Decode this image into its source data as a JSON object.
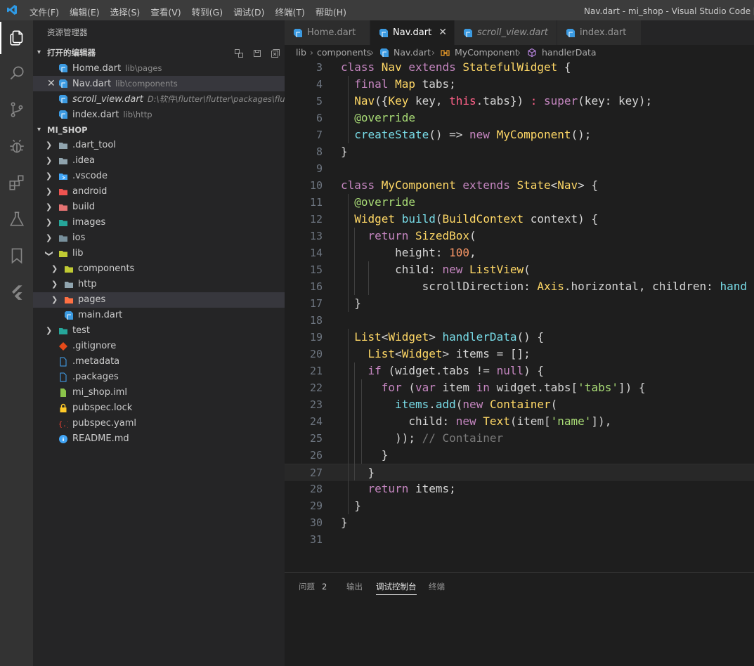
{
  "titlebar": {
    "menu": [
      "文件(F)",
      "编辑(E)",
      "选择(S)",
      "查看(V)",
      "转到(G)",
      "调试(D)",
      "终端(T)",
      "帮助(H)"
    ],
    "window_title": "Nav.dart - mi_shop - Visual Studio Code [管理"
  },
  "activity_bar": [
    "explorer-icon",
    "search-icon",
    "source-control-icon",
    "debug-icon",
    "extensions-icon",
    "test-icon",
    "bookmarks-icon",
    "flutter-icon"
  ],
  "sidebar": {
    "title": "资源管理器",
    "open_editors": {
      "header": "打开的编辑器",
      "items": [
        {
          "name": "Home.dart",
          "desc": "lib\\pages"
        },
        {
          "name": "Nav.dart",
          "desc": "lib\\components"
        },
        {
          "name": "scroll_view.dart",
          "desc": "D:\\软件\\flutter\\flutter\\packages\\flutter..."
        },
        {
          "name": "index.dart",
          "desc": "lib\\http"
        }
      ]
    },
    "project": {
      "header": "MI_SHOP",
      "items": [
        {
          "name": ".dart_tool"
        },
        {
          "name": ".idea"
        },
        {
          "name": ".vscode"
        },
        {
          "name": "android"
        },
        {
          "name": "build"
        },
        {
          "name": "images"
        },
        {
          "name": "ios"
        },
        {
          "name": "lib"
        },
        {
          "name": "components"
        },
        {
          "name": "http"
        },
        {
          "name": "pages"
        },
        {
          "name": "main.dart"
        },
        {
          "name": "test"
        },
        {
          "name": ".gitignore"
        },
        {
          "name": ".metadata"
        },
        {
          "name": ".packages"
        },
        {
          "name": "mi_shop.iml"
        },
        {
          "name": "pubspec.lock"
        },
        {
          "name": "pubspec.yaml"
        },
        {
          "name": "README.md"
        }
      ]
    }
  },
  "tabs": [
    "Home.dart",
    "Nav.dart",
    "scroll_view.dart",
    "index.dart"
  ],
  "breadcrumb": [
    "lib",
    "components",
    "Nav.dart",
    "MyComponent",
    "handlerData"
  ],
  "editor": {
    "line_numbers": [
      "3",
      "4",
      "5",
      "6",
      "7",
      "8",
      "9",
      "10",
      "11",
      "12",
      "13",
      "14",
      "15",
      "16",
      "17",
      "18",
      "19",
      "20",
      "21",
      "22",
      "23",
      "24",
      "25",
      "26",
      "27",
      "28",
      "29",
      "30",
      "31"
    ],
    "lines": [
      [
        [
          "k",
          "class "
        ],
        [
          "t",
          "Nav "
        ],
        [
          "k",
          "extends "
        ],
        [
          "t",
          "StatefulWidget "
        ],
        [
          "v",
          "{"
        ]
      ],
      [
        [
          "v",
          "  "
        ],
        [
          "k",
          "final "
        ],
        [
          "t",
          "Map "
        ],
        [
          "v",
          "tabs;"
        ]
      ],
      [
        [
          "v",
          "  "
        ],
        [
          "t",
          "Nav"
        ],
        [
          "v",
          "({"
        ],
        [
          "t",
          "Key "
        ],
        [
          "v",
          "key, "
        ],
        [
          "kw",
          "this"
        ],
        [
          "v",
          ".tabs}) "
        ],
        [
          "kw",
          ": "
        ],
        [
          "k",
          "super"
        ],
        [
          "v",
          "(key: key);"
        ]
      ],
      [
        [
          "v",
          "  "
        ],
        [
          "a",
          "@override"
        ]
      ],
      [
        [
          "v",
          "  "
        ],
        [
          "f",
          "createState"
        ],
        [
          "v",
          "() => "
        ],
        [
          "k",
          "new "
        ],
        [
          "t",
          "MyComponent"
        ],
        [
          "v",
          "();"
        ]
      ],
      [
        [
          "v",
          "}"
        ]
      ],
      [
        [
          "v",
          ""
        ]
      ],
      [
        [
          "k",
          "class "
        ],
        [
          "t",
          "MyComponent "
        ],
        [
          "k",
          "extends "
        ],
        [
          "t",
          "State"
        ],
        [
          "v",
          "<"
        ],
        [
          "t",
          "Nav"
        ],
        [
          "v",
          "> {"
        ]
      ],
      [
        [
          "v",
          "  "
        ],
        [
          "a",
          "@override"
        ]
      ],
      [
        [
          "v",
          "  "
        ],
        [
          "t",
          "Widget "
        ],
        [
          "f",
          "build"
        ],
        [
          "v",
          "("
        ],
        [
          "t",
          "BuildContext "
        ],
        [
          "v",
          "context) {"
        ]
      ],
      [
        [
          "v",
          "    "
        ],
        [
          "k",
          "return "
        ],
        [
          "t",
          "SizedBox"
        ],
        [
          "v",
          "("
        ]
      ],
      [
        [
          "v",
          "        height: "
        ],
        [
          "n",
          "100"
        ],
        [
          "v",
          ","
        ]
      ],
      [
        [
          "v",
          "        child: "
        ],
        [
          "k",
          "new "
        ],
        [
          "t",
          "ListView"
        ],
        [
          "v",
          "("
        ]
      ],
      [
        [
          "v",
          "            scrollDirection: "
        ],
        [
          "t",
          "Axis"
        ],
        [
          "v",
          ".horizontal, children: "
        ],
        [
          "f",
          "hand"
        ]
      ],
      [
        [
          "v",
          "  }"
        ]
      ],
      [
        [
          "v",
          ""
        ]
      ],
      [
        [
          "v",
          "  "
        ],
        [
          "t",
          "List"
        ],
        [
          "v",
          "<"
        ],
        [
          "t",
          "Widget"
        ],
        [
          "v",
          "> "
        ],
        [
          "f",
          "handlerData"
        ],
        [
          "v",
          "() {"
        ]
      ],
      [
        [
          "v",
          "    "
        ],
        [
          "t",
          "List"
        ],
        [
          "v",
          "<"
        ],
        [
          "t",
          "Widget"
        ],
        [
          "v",
          "> items = [];"
        ]
      ],
      [
        [
          "v",
          "    "
        ],
        [
          "k",
          "if "
        ],
        [
          "v",
          "(widget.tabs != "
        ],
        [
          "k",
          "null"
        ],
        [
          "v",
          ") {"
        ]
      ],
      [
        [
          "v",
          "      "
        ],
        [
          "k",
          "for "
        ],
        [
          "v",
          "("
        ],
        [
          "k",
          "var "
        ],
        [
          "v",
          "item "
        ],
        [
          "k",
          "in "
        ],
        [
          "v",
          "widget.tabs["
        ],
        [
          "s",
          "'tabs'"
        ],
        [
          "v",
          "]) {"
        ]
      ],
      [
        [
          "v",
          "        "
        ],
        [
          "f",
          "items"
        ],
        [
          "v",
          "."
        ],
        [
          "f",
          "add"
        ],
        [
          "v",
          "("
        ],
        [
          "k",
          "new "
        ],
        [
          "t",
          "Container"
        ],
        [
          "v",
          "("
        ]
      ],
      [
        [
          "v",
          "          child: "
        ],
        [
          "k",
          "new "
        ],
        [
          "t",
          "Text"
        ],
        [
          "v",
          "(item["
        ],
        [
          "s",
          "'name'"
        ],
        [
          "v",
          "]),"
        ]
      ],
      [
        [
          "v",
          "        )); "
        ],
        [
          "c",
          "// Container"
        ]
      ],
      [
        [
          "v",
          "      }"
        ]
      ],
      [
        [
          "v",
          "    }"
        ]
      ],
      [
        [
          "v",
          "    "
        ],
        [
          "k",
          "return "
        ],
        [
          "v",
          "items;"
        ]
      ],
      [
        [
          "v",
          "  }"
        ]
      ],
      [
        [
          "v",
          "}"
        ]
      ],
      [
        [
          "v",
          ""
        ]
      ]
    ]
  },
  "panel": {
    "tabs": [
      "问题",
      "输出",
      "调试控制台",
      "终端"
    ],
    "problems_count": "2"
  }
}
